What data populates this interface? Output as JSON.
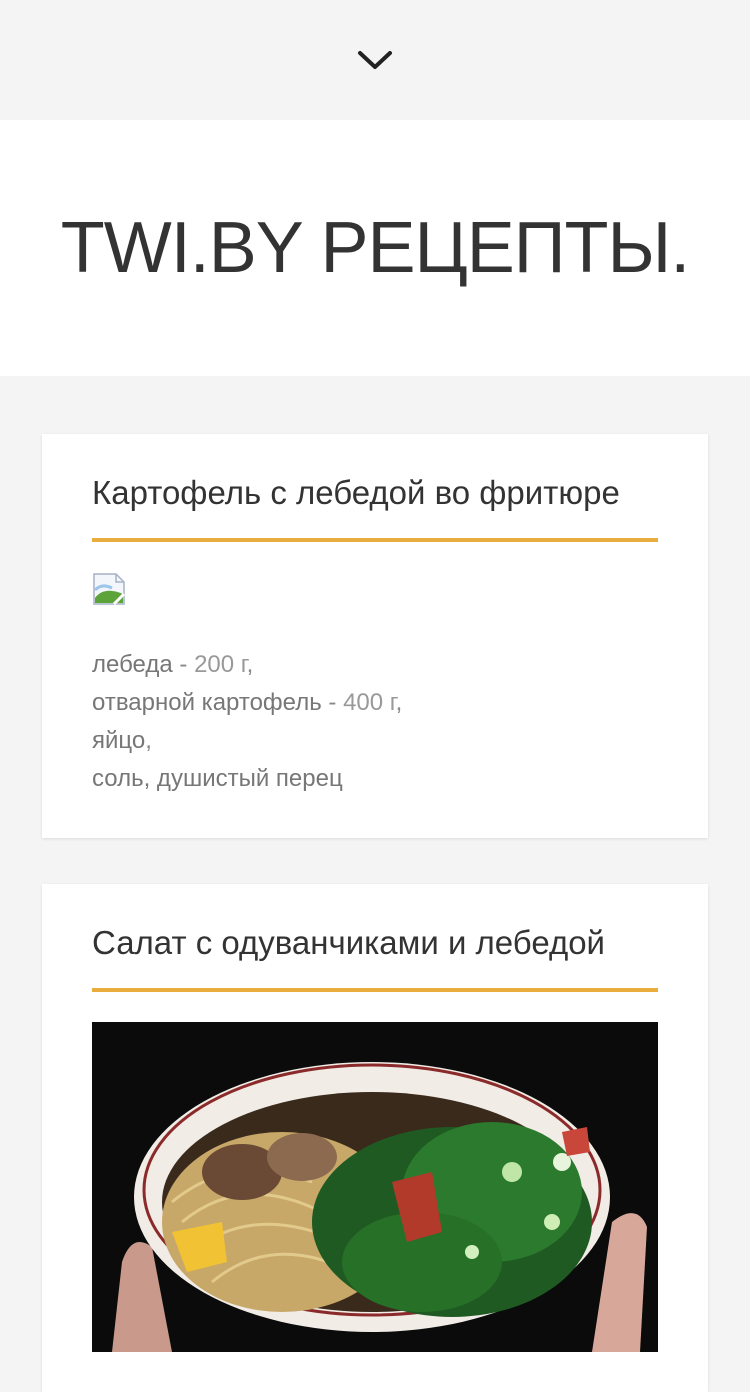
{
  "header": {
    "menu_toggle_icon": "chevron-down-icon",
    "site_title": "TWI.BY РЕЦЕПТЫ."
  },
  "colors": {
    "accent": "#e9ad3e",
    "page_bg": "#f4f4f4",
    "card_bg": "#ffffff",
    "title_text": "#333333",
    "muted_text": "#888888"
  },
  "posts": [
    {
      "title": "Картофель с лебедой во фритюре",
      "image_icon": "broken-image-icon",
      "ingredients": [
        {
          "name": "лебеда",
          "sep": " - ",
          "qty": "200 г",
          "trail": ","
        },
        {
          "name": "отварной картофель",
          "sep": " - ",
          "qty": "400 г",
          "trail": ","
        },
        {
          "name": "яйцо",
          "sep": "",
          "qty": "",
          "trail": ","
        },
        {
          "name": "соль, душистый перец",
          "sep": "",
          "qty": "",
          "trail": ""
        }
      ]
    },
    {
      "title": "Салат с одуванчиками и лебедой",
      "image_icon": "salad-photo"
    }
  ]
}
